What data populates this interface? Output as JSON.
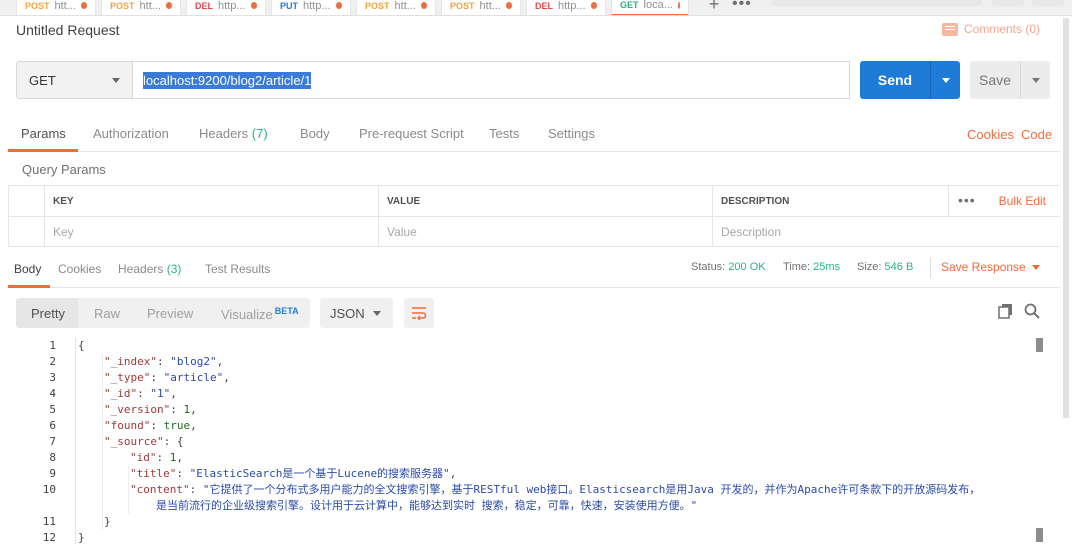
{
  "tabs": [
    {
      "method": "POST",
      "url": "htt...",
      "color": "#f3a33c"
    },
    {
      "method": "POST",
      "url": "htt...",
      "color": "#f3a33c"
    },
    {
      "method": "DEL",
      "url": "http...",
      "color": "#e04a4a"
    },
    {
      "method": "PUT",
      "url": "http...",
      "color": "#1f7bd8"
    },
    {
      "method": "POST",
      "url": "htt...",
      "color": "#f3a33c"
    },
    {
      "method": "POST",
      "url": "htt...",
      "color": "#f3a33c"
    },
    {
      "method": "DEL",
      "url": "http...",
      "color": "#e04a4a"
    },
    {
      "method": "GET",
      "url": "loca...",
      "color": "#26b47f"
    }
  ],
  "request": {
    "title": "Untitled Request",
    "comments_label": "Comments (0)",
    "method": "GET",
    "url": "localhost:9200/blog2/article/1",
    "send_label": "Send",
    "save_label": "Save"
  },
  "request_tabs": {
    "params": "Params",
    "authorization": "Authorization",
    "headers": "Headers",
    "headers_count": "(7)",
    "body": "Body",
    "prerequest": "Pre-request Script",
    "tests": "Tests",
    "settings": "Settings",
    "cookies": "Cookies",
    "code": "Code"
  },
  "query_params": {
    "title": "Query Params",
    "headers": {
      "key": "KEY",
      "value": "VALUE",
      "description": "DESCRIPTION"
    },
    "placeholders": {
      "key": "Key",
      "value": "Value",
      "description": "Description"
    },
    "bulk_edit": "Bulk Edit"
  },
  "response_tabs": {
    "body": "Body",
    "cookies": "Cookies",
    "headers": "Headers",
    "headers_count": "(3)",
    "test_results": "Test Results"
  },
  "response_meta": {
    "status_label": "Status:",
    "status_value": "200 OK",
    "time_label": "Time:",
    "time_value": "25ms",
    "size_label": "Size:",
    "size_value": "546 B",
    "save_response": "Save Response"
  },
  "view_options": {
    "pretty": "Pretty",
    "raw": "Raw",
    "preview": "Preview",
    "visualize": "Visualize",
    "beta": "BETA",
    "format": "JSON"
  },
  "code_lines": [
    {
      "n": "1",
      "parts": [
        {
          "t": "{",
          "c": "p"
        }
      ]
    },
    {
      "n": "2",
      "indent": 1,
      "parts": [
        {
          "t": "\"_index\"",
          "c": "k"
        },
        {
          "t": ": ",
          "c": "p"
        },
        {
          "t": "\"blog2\"",
          "c": "s"
        },
        {
          "t": ",",
          "c": "p"
        }
      ]
    },
    {
      "n": "3",
      "indent": 1,
      "parts": [
        {
          "t": "\"_type\"",
          "c": "k"
        },
        {
          "t": ": ",
          "c": "p"
        },
        {
          "t": "\"article\"",
          "c": "s"
        },
        {
          "t": ",",
          "c": "p"
        }
      ]
    },
    {
      "n": "4",
      "indent": 1,
      "parts": [
        {
          "t": "\"_id\"",
          "c": "k"
        },
        {
          "t": ": ",
          "c": "p"
        },
        {
          "t": "\"1\"",
          "c": "s"
        },
        {
          "t": ",",
          "c": "p"
        }
      ]
    },
    {
      "n": "5",
      "indent": 1,
      "parts": [
        {
          "t": "\"_version\"",
          "c": "k"
        },
        {
          "t": ": ",
          "c": "p"
        },
        {
          "t": "1",
          "c": "n"
        },
        {
          "t": ",",
          "c": "p"
        }
      ]
    },
    {
      "n": "6",
      "indent": 1,
      "parts": [
        {
          "t": "\"found\"",
          "c": "k"
        },
        {
          "t": ": ",
          "c": "p"
        },
        {
          "t": "true",
          "c": "n"
        },
        {
          "t": ",",
          "c": "p"
        }
      ]
    },
    {
      "n": "7",
      "indent": 1,
      "parts": [
        {
          "t": "\"_source\"",
          "c": "k"
        },
        {
          "t": ": {",
          "c": "p"
        }
      ]
    },
    {
      "n": "8",
      "indent": 2,
      "parts": [
        {
          "t": "\"id\"",
          "c": "k"
        },
        {
          "t": ": ",
          "c": "p"
        },
        {
          "t": "1",
          "c": "n"
        },
        {
          "t": ",",
          "c": "p"
        }
      ]
    },
    {
      "n": "9",
      "indent": 2,
      "parts": [
        {
          "t": "\"title\"",
          "c": "k"
        },
        {
          "t": ": ",
          "c": "p"
        },
        {
          "t": "\"ElasticSearch是一个基于Lucene的搜索服务器\"",
          "c": "s"
        },
        {
          "t": ",",
          "c": "p"
        }
      ]
    },
    {
      "n": "10",
      "indent": 2,
      "parts": [
        {
          "t": "\"content\"",
          "c": "k"
        },
        {
          "t": ": ",
          "c": "p"
        },
        {
          "t": "\"它提供了一个分布式多用户能力的全文搜索引擎，基于RESTful web接口。Elasticsearch是用Java 开发的，并作为Apache许可条款下的开放源码发布，",
          "c": "s"
        }
      ]
    },
    {
      "n": "",
      "indent": 3,
      "parts": [
        {
          "t": "是当前流行的企业级搜索引擎。设计用于云计算中，能够达到实时 搜索，稳定，可靠，快速，安装使用方便。\"",
          "c": "s"
        }
      ]
    },
    {
      "n": "11",
      "indent": 1,
      "parts": [
        {
          "t": "}",
          "c": "p"
        }
      ]
    },
    {
      "n": "12",
      "parts": [
        {
          "t": "}",
          "c": "p"
        }
      ]
    }
  ]
}
